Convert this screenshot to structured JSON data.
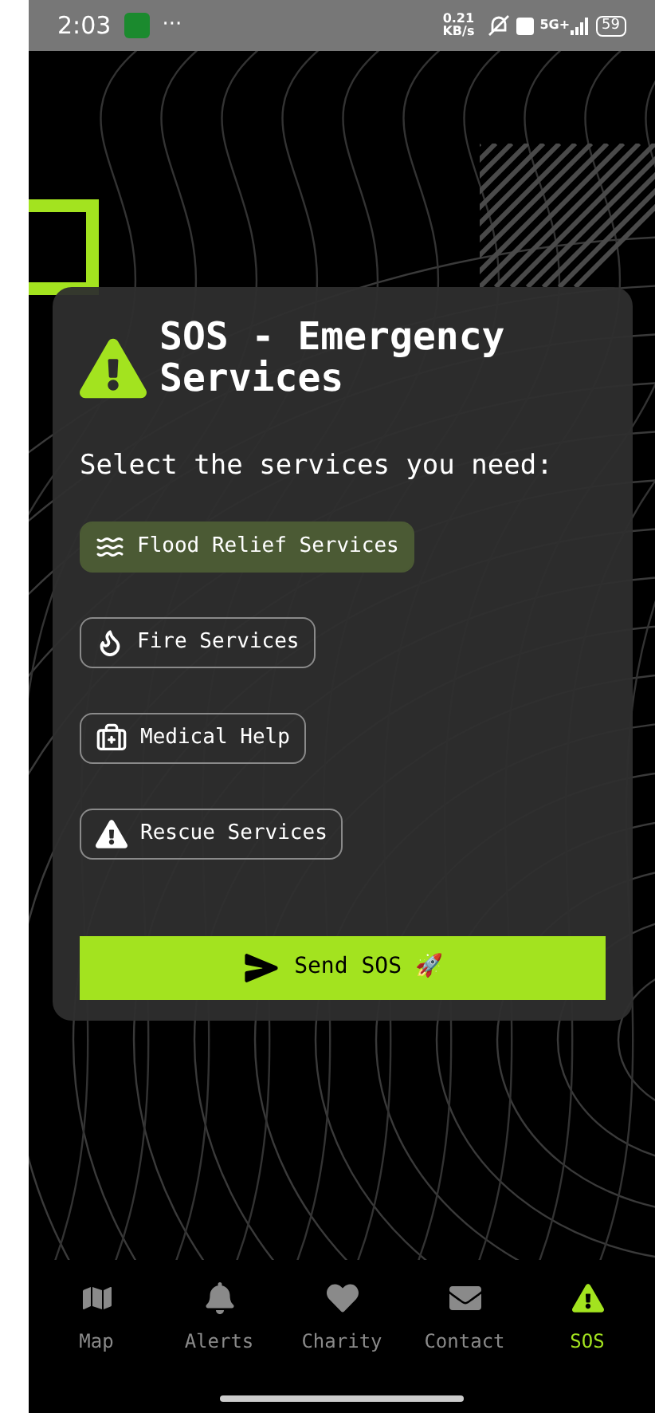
{
  "status_bar": {
    "time": "2:03",
    "more": "···",
    "speed": "0.21",
    "speed_unit": "KB/s",
    "network": "5G+",
    "battery": "59"
  },
  "card": {
    "title": "SOS - Emergency Services",
    "prompt": "Select the services you need:",
    "services": [
      {
        "label": "Flood Relief Services",
        "selected": true
      },
      {
        "label": "Fire Services",
        "selected": false
      },
      {
        "label": "Medical Help",
        "selected": false
      },
      {
        "label": "Rescue Services",
        "selected": false
      }
    ],
    "send_button": "Send SOS 🚀"
  },
  "nav": [
    {
      "label": "Map",
      "selected": false
    },
    {
      "label": "Alerts",
      "selected": false
    },
    {
      "label": "Charity",
      "selected": false
    },
    {
      "label": "Contact",
      "selected": false
    },
    {
      "label": "SOS",
      "selected": true
    }
  ]
}
